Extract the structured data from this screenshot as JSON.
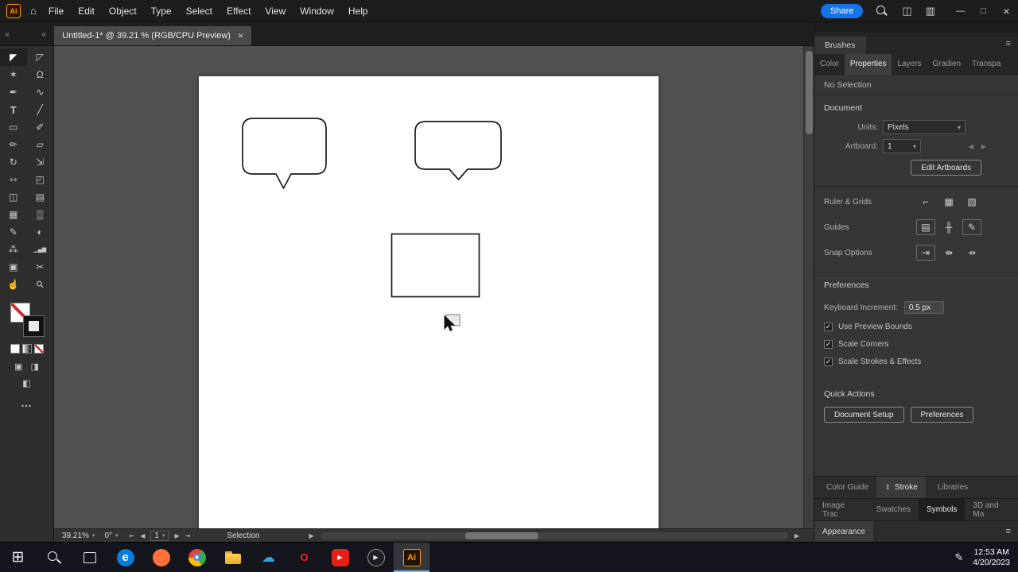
{
  "glyphs": {
    "chevrons_left": "«",
    "close": "×",
    "caret": "▾",
    "menu": "≡",
    "left_arrow": "◀",
    "right_arrow": "▶",
    "bar_left": "⇤",
    "bar_right": "⇥",
    "minimize": "—",
    "maximize": "□",
    "home": "⌂",
    "ellipsis": "…"
  },
  "menubar": {
    "app_badge": "Ai",
    "share_label": "Share",
    "accent_blue": "#1473e6",
    "workspace_icon": "◫",
    "panel_icon": "▥",
    "menus": [
      {
        "name": "menu-file",
        "label": "File"
      },
      {
        "name": "menu-edit",
        "label": "Edit"
      },
      {
        "name": "menu-object",
        "label": "Object"
      },
      {
        "name": "menu-type",
        "label": "Type"
      },
      {
        "name": "menu-select",
        "label": "Select"
      },
      {
        "name": "menu-effect",
        "label": "Effect"
      },
      {
        "name": "menu-view",
        "label": "View"
      },
      {
        "name": "menu-window",
        "label": "Window"
      },
      {
        "name": "menu-help",
        "label": "Help"
      }
    ]
  },
  "tab": {
    "title": "Untitled-1* @ 39.21 % (RGB/CPU Preview)"
  },
  "toolbar": {
    "tools": [
      {
        "name": "selection-tool",
        "glyph": "◤"
      },
      {
        "name": "direct-selection-tool",
        "glyph": "◸"
      },
      {
        "name": "magic-wand-tool",
        "glyph": "✶"
      },
      {
        "name": "lasso-tool",
        "glyph": "Ω"
      },
      {
        "name": "pen-tool",
        "glyph": "✒"
      },
      {
        "name": "curvature-tool",
        "glyph": "∿"
      },
      {
        "name": "type-tool",
        "glyph": "T"
      },
      {
        "name": "line-segment-tool",
        "glyph": "╱"
      },
      {
        "name": "rectangle-tool",
        "glyph": "▭"
      },
      {
        "name": "paintbrush-tool",
        "glyph": "✐"
      },
      {
        "name": "pencil-tool",
        "glyph": "✏"
      },
      {
        "name": "eraser-tool",
        "glyph": "▱"
      },
      {
        "name": "rotate-tool",
        "glyph": "↻"
      },
      {
        "name": "scale-tool",
        "glyph": "⇲"
      },
      {
        "name": "width-tool",
        "glyph": "⇿"
      },
      {
        "name": "free-transform-tool",
        "glyph": "◰"
      },
      {
        "name": "shape-builder-tool",
        "glyph": "◫"
      },
      {
        "name": "perspective-grid-tool",
        "glyph": "▤"
      },
      {
        "name": "mesh-tool",
        "glyph": "▦"
      },
      {
        "name": "gradient-tool",
        "glyph": "▒"
      },
      {
        "name": "eyedropper-tool",
        "glyph": "✎"
      },
      {
        "name": "blend-tool",
        "glyph": "◐"
      },
      {
        "name": "symbol-sprayer-tool",
        "glyph": "⁂"
      },
      {
        "name": "column-graph-tool",
        "glyph": "▁▄▆"
      },
      {
        "name": "artboard-tool",
        "glyph": "▣"
      },
      {
        "name": "slice-tool",
        "glyph": "✂"
      },
      {
        "name": "hand-tool",
        "glyph": "☝"
      },
      {
        "name": "zoom-tool",
        "glyph": "⚲"
      }
    ],
    "extras": {
      "draw_a": "▣",
      "draw_b": "◨",
      "screen": "◧"
    }
  },
  "statusbar": {
    "zoom": "39.21%",
    "rotation": "0°",
    "artboard": "1",
    "mode": "Selection"
  },
  "panel": {
    "brushes_tab": "Brushes",
    "tabs": [
      {
        "name": "panel-tab-color",
        "label": "Color"
      },
      {
        "name": "panel-tab-properties",
        "label": "Properties",
        "active": true
      },
      {
        "name": "panel-tab-layers",
        "label": "Layers"
      },
      {
        "name": "panel-tab-gradient",
        "label": "Gradien"
      },
      {
        "name": "panel-tab-transparency",
        "label": "Transpa"
      }
    ],
    "no_selection": "No Selection",
    "document": {
      "title": "Document",
      "units_label": "Units:",
      "units_value": "Pixels",
      "artboard_label": "Artboard:",
      "artboard_value": "1",
      "edit_artboards_label": "Edit Artboards"
    },
    "ruler_grids": {
      "label": "Ruler & Grids",
      "icons": [
        {
          "name": "show-rulers-icon",
          "glyph": "⌐"
        },
        {
          "name": "show-grid-icon",
          "glyph": "▦"
        },
        {
          "name": "transparency-grid-icon",
          "glyph": "▨"
        }
      ]
    },
    "guides": {
      "label": "Guides",
      "icons": [
        {
          "name": "show-guides-icon",
          "glyph": "▤",
          "boxed": true
        },
        {
          "name": "lock-guides-icon",
          "glyph": "╫"
        },
        {
          "name": "edit-guides-icon",
          "glyph": "✎",
          "boxed": true
        }
      ]
    },
    "snap": {
      "label": "Snap Options",
      "icons": [
        {
          "name": "snap-to-point-icon",
          "glyph": "⇥",
          "boxed": true
        },
        {
          "name": "snap-to-grid-icon",
          "glyph": "⇻"
        },
        {
          "name": "snap-to-glyph-icon",
          "glyph": "⇸"
        }
      ]
    },
    "preferences": {
      "title": "Preferences",
      "increment_label": "Keyboard Increment:",
      "increment_value": "0.5 px",
      "checkboxes": [
        {
          "name": "use-preview-bounds-checkbox",
          "label": "Use Preview Bounds",
          "check": "✓"
        },
        {
          "name": "scale-corners-checkbox",
          "label": "Scale Corners",
          "check": "✓"
        },
        {
          "name": "scale-strokes-effects-checkbox",
          "label": "Scale Strokes & Effects",
          "check": "✓"
        }
      ]
    },
    "quick_actions": {
      "title": "Quick Actions",
      "buttons": [
        {
          "name": "document-setup-button",
          "label": "Document Setup"
        },
        {
          "name": "preferences-button",
          "label": "Preferences"
        }
      ]
    },
    "bottom_row1": [
      {
        "name": "tab-color-guide",
        "label": "Color Guide"
      },
      {
        "name": "tab-stroke",
        "label": "Stroke",
        "icon": "⇕",
        "active": true
      },
      {
        "name": "tab-libraries",
        "label": "Libraries"
      }
    ],
    "bottom_row2": [
      {
        "name": "tab-image-trace",
        "label": "Image Trac"
      },
      {
        "name": "tab-swatches",
        "label": "Swatches"
      },
      {
        "name": "tab-symbols",
        "label": "Symbols",
        "active": true
      },
      {
        "name": "tab-3d-materials",
        "label": "3D and Ma"
      }
    ],
    "appearance_tab": "Appearance"
  },
  "taskbar": {
    "icons": [
      {
        "name": "start-icon",
        "glyph": "⊞",
        "fg": "#e8eaed"
      },
      {
        "name": "search-icon"
      },
      {
        "name": "task-view-icon"
      },
      {
        "name": "edge-icon",
        "glyph": "e",
        "bg": "#0b7dd8",
        "fg": "#ffffff"
      },
      {
        "name": "firefox-icon",
        "bg": "#ff7139"
      },
      {
        "name": "chrome-icon"
      },
      {
        "name": "file-explorer-icon"
      },
      {
        "name": "onedrive-icon",
        "glyph": "☁",
        "fg": "#28a8ea"
      },
      {
        "name": "opera-icon",
        "glyph": "O",
        "bg": "#151515",
        "fg": "#ff1b2d"
      },
      {
        "name": "youtube-icon",
        "glyph": "▶",
        "bg": "#e62117",
        "fg": "#ffffff"
      },
      {
        "name": "media-player-icon",
        "glyph": "▶",
        "bg": "#1f1f1f",
        "fg": "#f2f2f2"
      },
      {
        "name": "illustrator-icon",
        "glyph": "Ai",
        "bg": "#241403",
        "fg": "#ff9a00",
        "active": true
      }
    ],
    "pen_icon": "✎",
    "time": "12:53 AM",
    "date": "4/20/2023"
  }
}
